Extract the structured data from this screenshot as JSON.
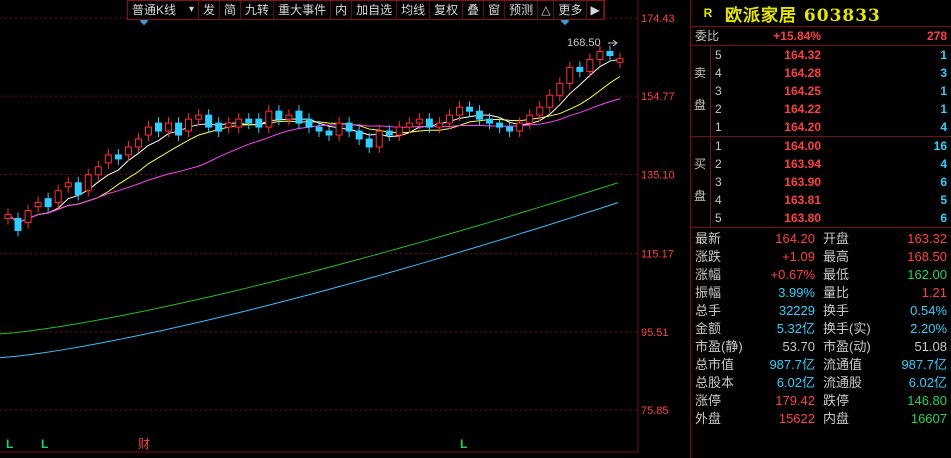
{
  "toolbar": {
    "items": [
      "普通K线",
      "发",
      "简",
      "九转",
      "重大事件",
      "内",
      "加自选",
      "均线",
      "复权",
      "叠",
      "窗",
      "预测",
      "△",
      "更多",
      "▶"
    ],
    "selector_arrow": "▾"
  },
  "chart": {
    "price_labels": [
      "174.43",
      "154.77",
      "135.10",
      "115.17",
      "95.51",
      "75.85"
    ],
    "price_levels": [
      174.43,
      154.77,
      135.1,
      115.17,
      95.51,
      75.85
    ],
    "high_label": "168.50",
    "bottom_markers": [
      "L",
      "L",
      "财",
      "L"
    ],
    "colors": {
      "up": "#ff3030",
      "down": "#33ccff",
      "ma5": "#ffffff",
      "ma10": "#ffff40",
      "ma20": "#ff40ff",
      "ma30": "#20c020",
      "ma60": "#33c0ff",
      "grid": "#7a0e0e"
    }
  },
  "chart_data": {
    "type": "candlestick",
    "y_range": [
      75.85,
      174.43
    ],
    "close": [
      125,
      121,
      126,
      128,
      127,
      131,
      133,
      130,
      135,
      137,
      140,
      139,
      142,
      144,
      147,
      146,
      148,
      145,
      149,
      150,
      147,
      146,
      148,
      149,
      148,
      147,
      151,
      149,
      150,
      148,
      147,
      146,
      145,
      148,
      146,
      144,
      142,
      146,
      145,
      147,
      148,
      149,
      147,
      148,
      150,
      152,
      151,
      149,
      148,
      147,
      146,
      148,
      150,
      152,
      155,
      158,
      162,
      161,
      164,
      166,
      165,
      164.2
    ],
    "opens": [
      124,
      124,
      123,
      127,
      129,
      128,
      132,
      133,
      131,
      135,
      138,
      140,
      140,
      142,
      145,
      148,
      146,
      148,
      146,
      149,
      150,
      148,
      147,
      147,
      149,
      149,
      147,
      151,
      149,
      151,
      149,
      147,
      146,
      145,
      148,
      146,
      144,
      142,
      146,
      145,
      147,
      148,
      149,
      147,
      148,
      150,
      152,
      151,
      149,
      148,
      147,
      146,
      148,
      150,
      152,
      155,
      158,
      162,
      161,
      164,
      166,
      163.32
    ]
  },
  "quote": {
    "r_tag": "R",
    "name": "欧派家居 603833",
    "weibi_label": "委比",
    "weibi_pct": "+15.84%",
    "weibi_val": "278",
    "sell_label_1": "卖",
    "sell_label_2": "盘",
    "buy_label_1": "买",
    "buy_label_2": "盘",
    "sell": [
      {
        "lvl": "5",
        "price": "164.32",
        "vol": "1"
      },
      {
        "lvl": "4",
        "price": "164.28",
        "vol": "3"
      },
      {
        "lvl": "3",
        "price": "164.25",
        "vol": "1"
      },
      {
        "lvl": "2",
        "price": "164.22",
        "vol": "1"
      },
      {
        "lvl": "1",
        "price": "164.20",
        "vol": "4"
      }
    ],
    "buy": [
      {
        "lvl": "1",
        "price": "164.00",
        "vol": "16"
      },
      {
        "lvl": "2",
        "price": "163.94",
        "vol": "4"
      },
      {
        "lvl": "3",
        "price": "163.90",
        "vol": "6"
      },
      {
        "lvl": "4",
        "price": "163.81",
        "vol": "5"
      },
      {
        "lvl": "5",
        "price": "163.80",
        "vol": "6"
      }
    ],
    "stats": [
      {
        "l1": "最新",
        "v1": "164.20",
        "c1": "red",
        "l2": "开盘",
        "v2": "163.32",
        "c2": "red"
      },
      {
        "l1": "涨跌",
        "v1": "+1.09",
        "c1": "red",
        "l2": "最高",
        "v2": "168.50",
        "c2": "red"
      },
      {
        "l1": "涨幅",
        "v1": "+0.67%",
        "c1": "red",
        "l2": "最低",
        "v2": "162.00",
        "c2": "green"
      },
      {
        "l1": "振幅",
        "v1": "3.99%",
        "c1": "cyan",
        "l2": "量比",
        "v2": "1.21",
        "c2": "red"
      },
      {
        "l1": "总手",
        "v1": "32229",
        "c1": "cyan",
        "l2": "换手",
        "v2": "0.54%",
        "c2": "cyan"
      },
      {
        "l1": "金额",
        "v1": "5.32亿",
        "c1": "cyan",
        "l2": "换手(实)",
        "v2": "2.20%",
        "c2": "cyan"
      },
      {
        "l1": "市盈(静)",
        "v1": "53.70",
        "c1": "grey",
        "l2": "市盈(动)",
        "v2": "51.08",
        "c2": "grey"
      },
      {
        "l1": "总市值",
        "v1": "987.7亿",
        "c1": "cyan",
        "l2": "流通值",
        "v2": "987.7亿",
        "c2": "cyan"
      },
      {
        "l1": "总股本",
        "v1": "6.02亿",
        "c1": "cyan",
        "l2": "流通股",
        "v2": "6.02亿",
        "c2": "cyan"
      },
      {
        "l1": "涨停",
        "v1": "179.42",
        "c1": "red",
        "l2": "跌停",
        "v2": "146.80",
        "c2": "green"
      },
      {
        "l1": "外盘",
        "v1": "15622",
        "c1": "red",
        "l2": "内盘",
        "v2": "16607",
        "c2": "green"
      }
    ]
  }
}
